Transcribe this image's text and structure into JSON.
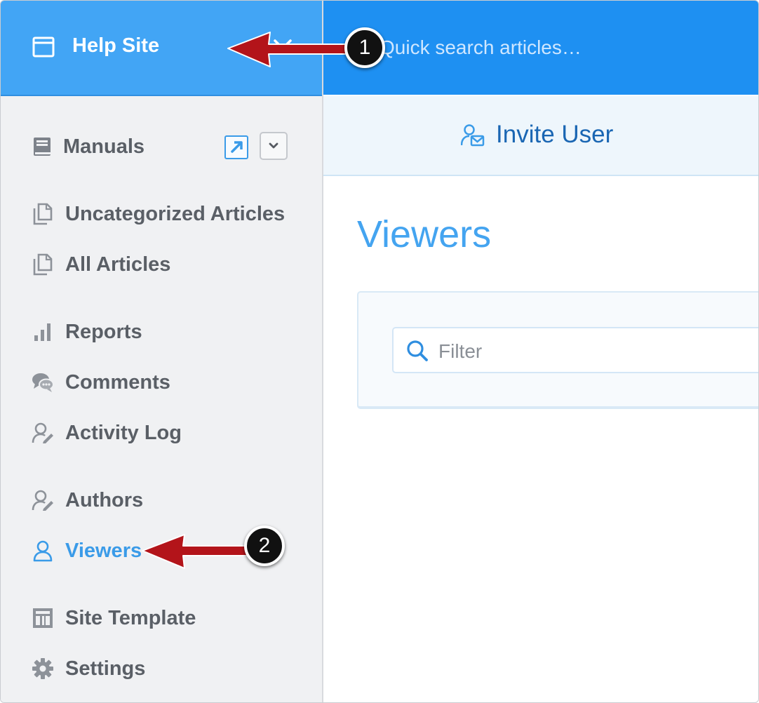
{
  "site": {
    "name": "Help Site",
    "icon": "window-icon"
  },
  "search": {
    "placeholder": "Quick search articles…"
  },
  "sidebar": {
    "manuals_label": "Manuals",
    "items": [
      {
        "label": "Uncategorized Articles",
        "icon": "documents-icon"
      },
      {
        "label": "All Articles",
        "icon": "documents-icon"
      },
      {
        "label": "Reports",
        "icon": "bar-chart-icon"
      },
      {
        "label": "Comments",
        "icon": "chat-bubbles-icon"
      },
      {
        "label": "Activity Log",
        "icon": "user-edit-icon"
      },
      {
        "label": "Authors",
        "icon": "user-edit-icon"
      },
      {
        "label": "Viewers",
        "icon": "user-icon",
        "active": true
      },
      {
        "label": "Site Template",
        "icon": "template-icon"
      },
      {
        "label": "Settings",
        "icon": "gear-icon"
      }
    ]
  },
  "toolbar": {
    "invite_label": "Invite User"
  },
  "main": {
    "title": "Viewers",
    "filter_placeholder": "Filter"
  },
  "annotations": [
    {
      "number": "1"
    },
    {
      "number": "2"
    }
  ],
  "colors": {
    "header_blue": "#42a5f5",
    "topbar_blue": "#1e90f2",
    "accent": "#3a9be8",
    "sidebar_bg": "#f0f1f3",
    "arrow_red": "#b3141a"
  }
}
